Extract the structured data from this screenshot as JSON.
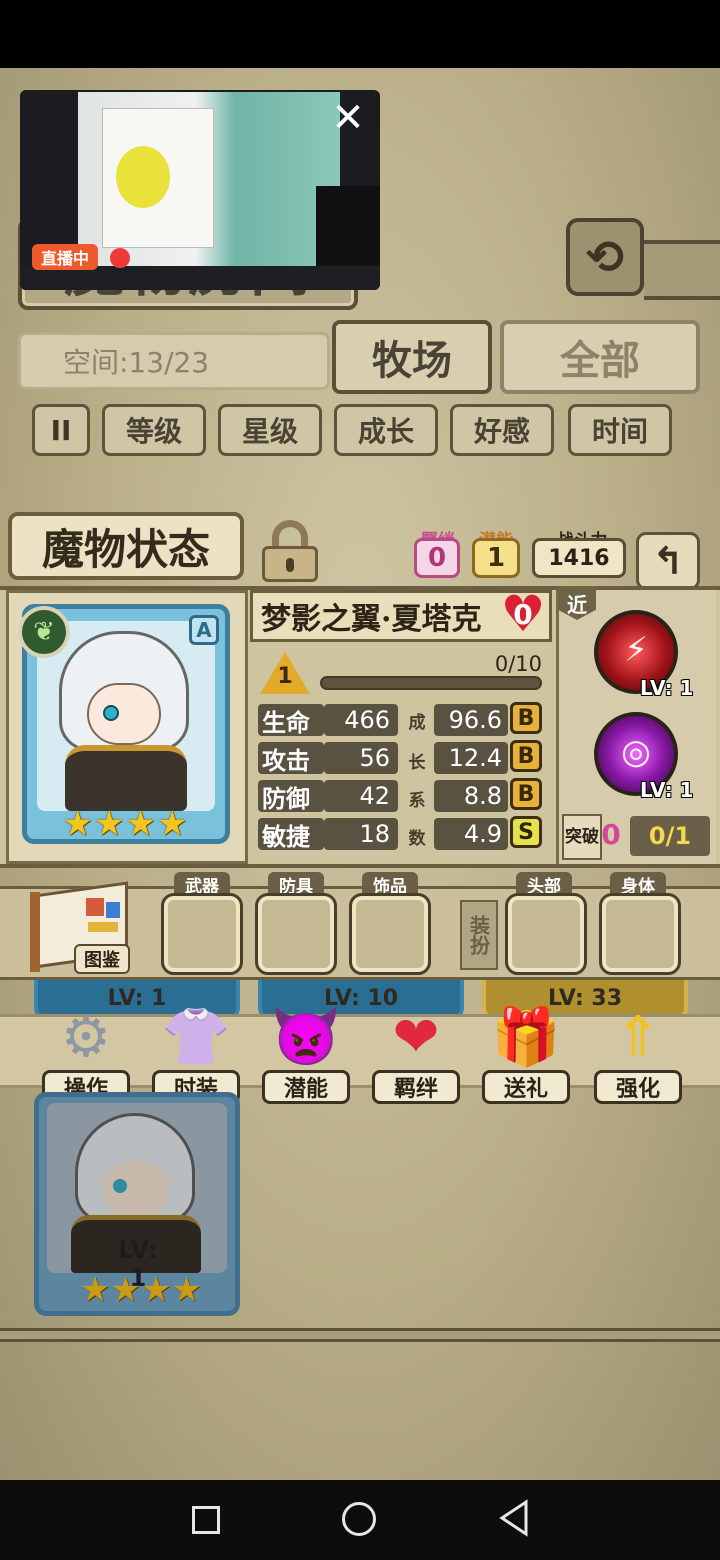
{
  "room": {
    "title": "魔物房间",
    "space_label": "空间:13/23",
    "tab_ranch": "牧场",
    "tab_all": "全部",
    "sort_buttons": [
      "等级",
      "星级",
      "成长",
      "好感",
      "时间"
    ]
  },
  "status": {
    "title": "魔物状态",
    "bond_label": "羁绊",
    "bond_value": "0",
    "potential_label": "潜能",
    "potential_value": "1",
    "power_label": "战斗力",
    "power_value": "1416"
  },
  "monster": {
    "name": "梦影之翼·夏塔克",
    "affection": "0",
    "level": "1",
    "exp": "0/10",
    "exp_progress": 0,
    "grade": "A",
    "stars": 4,
    "attribute_icon": "leaf-icon",
    "stats": [
      {
        "label": "生命",
        "value": "466",
        "growth": "96.6",
        "rank": "B"
      },
      {
        "label": "攻击",
        "value": "56",
        "growth": "12.4",
        "rank": "B"
      },
      {
        "label": "防御",
        "value": "42",
        "growth": "8.8",
        "rank": "B"
      },
      {
        "label": "敏捷",
        "value": "18",
        "growth": "4.9",
        "rank": "S"
      }
    ],
    "growth_chars": [
      "成",
      "长",
      "系",
      "数"
    ],
    "range_tag": "近",
    "skills": [
      {
        "icon": "slash-skill-icon",
        "level": "LV: 1"
      },
      {
        "icon": "vortex-skill-icon",
        "level": "LV: 1"
      }
    ],
    "breakthrough_label": "突破",
    "breakthrough_count": "0",
    "breakthrough_progress": "0/1"
  },
  "equipment": {
    "book_label": "图鉴",
    "slots": [
      "武器",
      "防具",
      "饰品"
    ],
    "dress_label": "装扮",
    "dress_slots": [
      "头部",
      "身体"
    ]
  },
  "background_cards": [
    "LV: 1",
    "LV: 10",
    "LV: 33"
  ],
  "actions": [
    {
      "label": "操作",
      "icon": "gear-icon"
    },
    {
      "label": "时装",
      "icon": "outfit-icon"
    },
    {
      "label": "潜能",
      "icon": "demon-icon"
    },
    {
      "label": "羁绊",
      "icon": "hearts-icon"
    },
    {
      "label": "送礼",
      "icon": "gift-icon"
    },
    {
      "label": "强化",
      "icon": "upgrade-arrows-icon"
    }
  ],
  "lower_card": {
    "level": "LV: 1",
    "stars": 4
  },
  "video_overlay": {
    "live_label": "直播中"
  },
  "colors": {
    "rank_b": "#e8b23a",
    "rank_s": "#e7e24b",
    "bond_pink": "#c54f8f",
    "heart_red": "#d92034",
    "card_blue": "#7ac2dc"
  }
}
